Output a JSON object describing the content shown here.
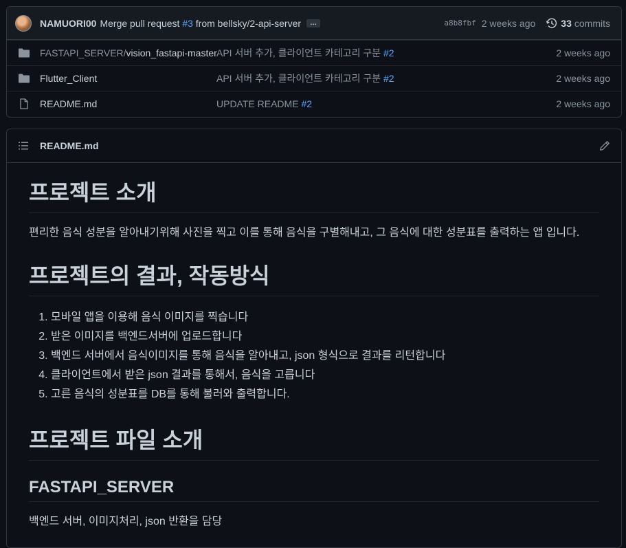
{
  "commit": {
    "author": "NAMUORI00",
    "message_prefix": "Merge pull request",
    "pr_ref": "#3",
    "message_suffix": "from bellsky/2-api-server",
    "ellipsis": "…",
    "sha": "a8b8fbf",
    "time": "2 weeks ago",
    "commit_count": "33",
    "commit_label": "commits"
  },
  "files": [
    {
      "icon": "folder-icon",
      "name_prefix": "FASTAPI_SERVER/",
      "name": "vision_fastapi-master",
      "message": "API 서버 추가, 클라이언트 카테고리 구분",
      "ref": "#2",
      "date": "2 weeks ago"
    },
    {
      "icon": "folder-icon",
      "name_prefix": "",
      "name": "Flutter_Client",
      "message": "API 서버 추가, 클라이언트 카테고리 구분",
      "ref": "#2",
      "date": "2 weeks ago"
    },
    {
      "icon": "file-icon",
      "name_prefix": "",
      "name": "README.md",
      "message": "UPDATE README",
      "ref": "#2",
      "date": "2 weeks ago"
    }
  ],
  "readme": {
    "filename": "README.md",
    "h1_intro": "프로젝트 소개",
    "p_intro": "편리한 음식 성분을 알아내기위해 사진을 찍고 이를 통해 음식을 구별해내고, 그 음식에 대한 성분표를 출력하는 앱 입니다.",
    "h1_result": "프로젝트의 결과, 작동방식",
    "steps": [
      "모바일 앱을 이용해 음식 이미지를 찍습니다",
      "받은 이미지를 백엔드서버에 업로드합니다",
      "백엔드 서버에서 음식이미지를 통해 음식을 알아내고, json 형식으로 결과를 리턴합니다",
      "클라이언트에서 받은 json 결과를 통해서, 음식을 고릅니다",
      "고른 음식의 성분표를 DB를 통해 불러와 출력합니다."
    ],
    "h1_files": "프로젝트 파일 소개",
    "h2_server": "FASTAPI_SERVER",
    "p_server": "백엔드 서버, 이미지처리, json 반환을 담당"
  },
  "colors": {
    "background": "#0d1117",
    "header_bg": "#161b22",
    "border": "#30363d",
    "text": "#c9d1d9",
    "muted": "#8b949e",
    "link": "#58a6ff",
    "folder": "#8b949e"
  }
}
